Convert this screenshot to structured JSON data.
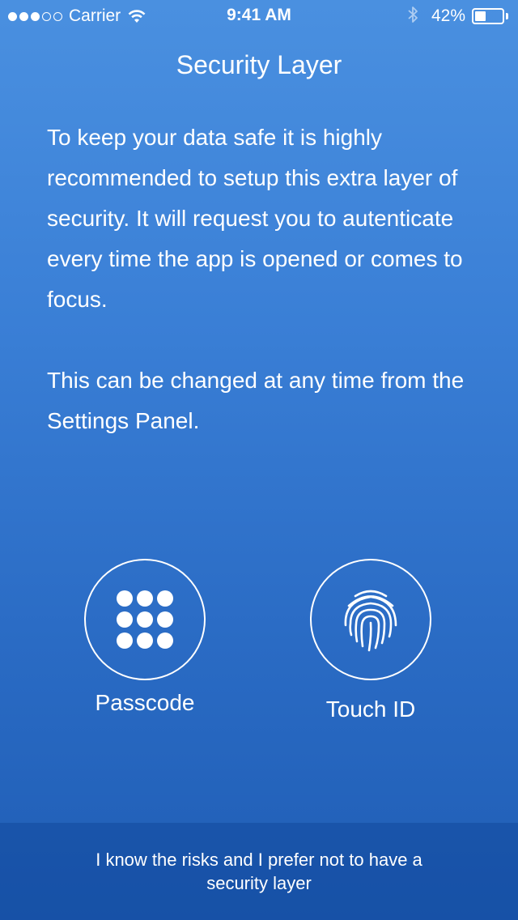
{
  "status_bar": {
    "carrier": "Carrier",
    "time": "9:41 AM",
    "battery_percent": "42%",
    "battery_level": 0.42,
    "signal_bars_filled": 3,
    "signal_bars_total": 5
  },
  "page": {
    "title": "Security Layer",
    "description_1": "To keep your data safe it is highly recommended to setup this extra layer of security. It will request you to autenticate every time the app is opened or comes to focus.",
    "description_2": "This can be changed at any time from the Settings Panel."
  },
  "options": {
    "passcode": {
      "label": "Passcode",
      "icon": "keypad-icon"
    },
    "touch_id": {
      "label": "Touch ID",
      "icon": "fingerprint-icon"
    }
  },
  "footer": {
    "skip_text": "I know the risks and I prefer not to have a security layer"
  },
  "colors": {
    "background_top": "#4a90e0",
    "background_bottom": "#1f5db5",
    "text": "#ffffff"
  }
}
